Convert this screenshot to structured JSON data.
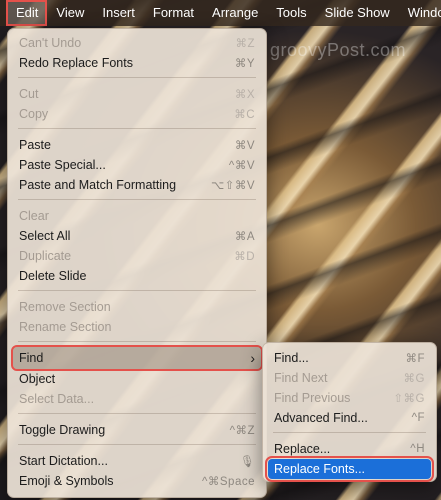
{
  "menubar": {
    "items": [
      "Edit",
      "View",
      "Insert",
      "Format",
      "Arrange",
      "Tools",
      "Slide Show",
      "Windo"
    ]
  },
  "watermark": "groovyPost.com",
  "edit_menu": {
    "items": [
      {
        "label": "Can't Undo",
        "shortcut": "⌘Z"
      },
      {
        "label": "Redo Replace Fonts",
        "shortcut": "⌘Y"
      },
      {
        "label": "Cut",
        "shortcut": "⌘X"
      },
      {
        "label": "Copy",
        "shortcut": "⌘C"
      },
      {
        "label": "Paste",
        "shortcut": "⌘V"
      },
      {
        "label": "Paste Special...",
        "shortcut": "^⌘V"
      },
      {
        "label": "Paste and Match Formatting",
        "shortcut": "⌥⇧⌘V"
      },
      {
        "label": "Clear",
        "shortcut": ""
      },
      {
        "label": "Select All",
        "shortcut": "⌘A"
      },
      {
        "label": "Duplicate",
        "shortcut": "⌘D"
      },
      {
        "label": "Delete Slide",
        "shortcut": ""
      },
      {
        "label": "Remove Section",
        "shortcut": ""
      },
      {
        "label": "Rename Section",
        "shortcut": ""
      },
      {
        "label": "Find",
        "shortcut": "›"
      },
      {
        "label": "Object",
        "shortcut": ""
      },
      {
        "label": "Select Data...",
        "shortcut": ""
      },
      {
        "label": "Toggle Drawing",
        "shortcut": "^⌘Z"
      },
      {
        "label": "Start Dictation...",
        "shortcut": "🎙"
      },
      {
        "label": "Emoji & Symbols",
        "shortcut": "^⌘Space"
      }
    ]
  },
  "find_submenu": {
    "items": [
      {
        "label": "Find...",
        "shortcut": "⌘F"
      },
      {
        "label": "Find Next",
        "shortcut": "⌘G"
      },
      {
        "label": "Find Previous",
        "shortcut": "⇧⌘G"
      },
      {
        "label": "Advanced Find...",
        "shortcut": "^F"
      },
      {
        "label": "Replace...",
        "shortcut": "^H"
      },
      {
        "label": "Replace Fonts...",
        "shortcut": ""
      }
    ]
  },
  "colors": {
    "highlight_outline": "#e4514b",
    "selection_blue": "#1b6fd9"
  }
}
